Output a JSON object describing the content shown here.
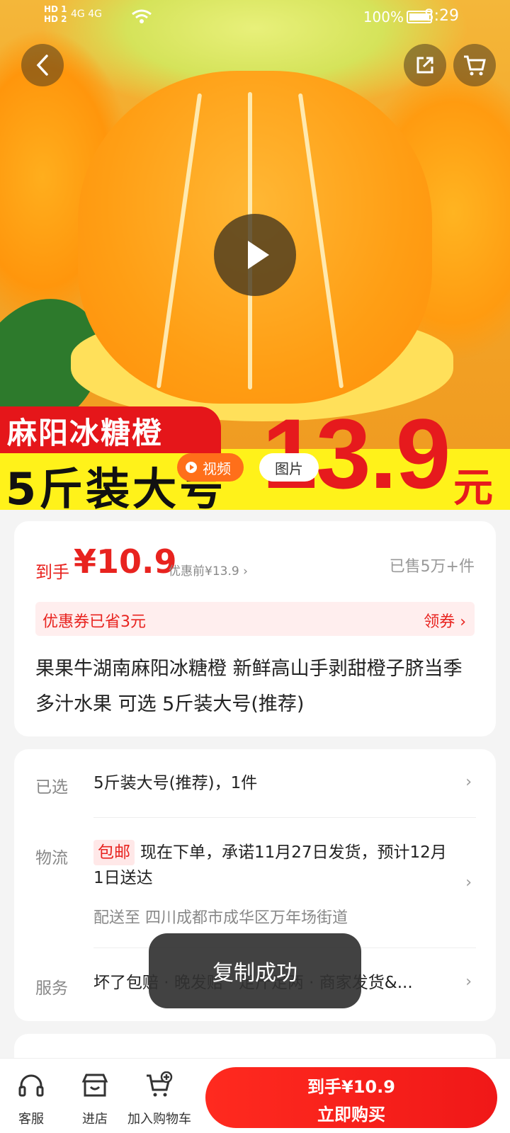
{
  "status_bar": {
    "left_sim1": "HD 1",
    "left_sim2": "HD 2",
    "network": "4G 4G",
    "battery_percent": "100%",
    "time": "8:29"
  },
  "hero": {
    "banner_title": "麻阳冰糖橙",
    "banner_subtitle": "5斤装大号",
    "banner_price": "13.9",
    "banner_unit": "元",
    "tab_video": "视频",
    "tab_image": "图片"
  },
  "price_card": {
    "price_label": "到手",
    "price_value": "¥10.9",
    "price_before": "优惠前¥13.9 ›",
    "sold": "已售5万+件",
    "coupon_text": "优惠券已省3元",
    "coupon_action": "领券 ›",
    "product_title": "果果牛湖南麻阳冰糖橙 新鲜高山手剥甜橙子脐当季多汁水果 可选 5斤装大号(推荐)"
  },
  "details_card": {
    "selected_label": "已选",
    "selected_value": "5斤装大号(推荐)，1件",
    "logistics_label": "物流",
    "logistics_badge": "包邮",
    "logistics_text": "现在下单，承诺11月27日发货，预计12月1日送达",
    "ship_to": "配送至  四川成都市成华区万年场街道",
    "service_label": "服务",
    "service_value": "坏了包赔 · 晚发赔 · 足斤足两 · 商家发货&..."
  },
  "toast": "复制成功",
  "bottom_bar": {
    "service": "客服",
    "store": "进店",
    "add_cart": "加入购物车",
    "buy_line1": "到手¥10.9",
    "buy_line2": "立即购买"
  }
}
